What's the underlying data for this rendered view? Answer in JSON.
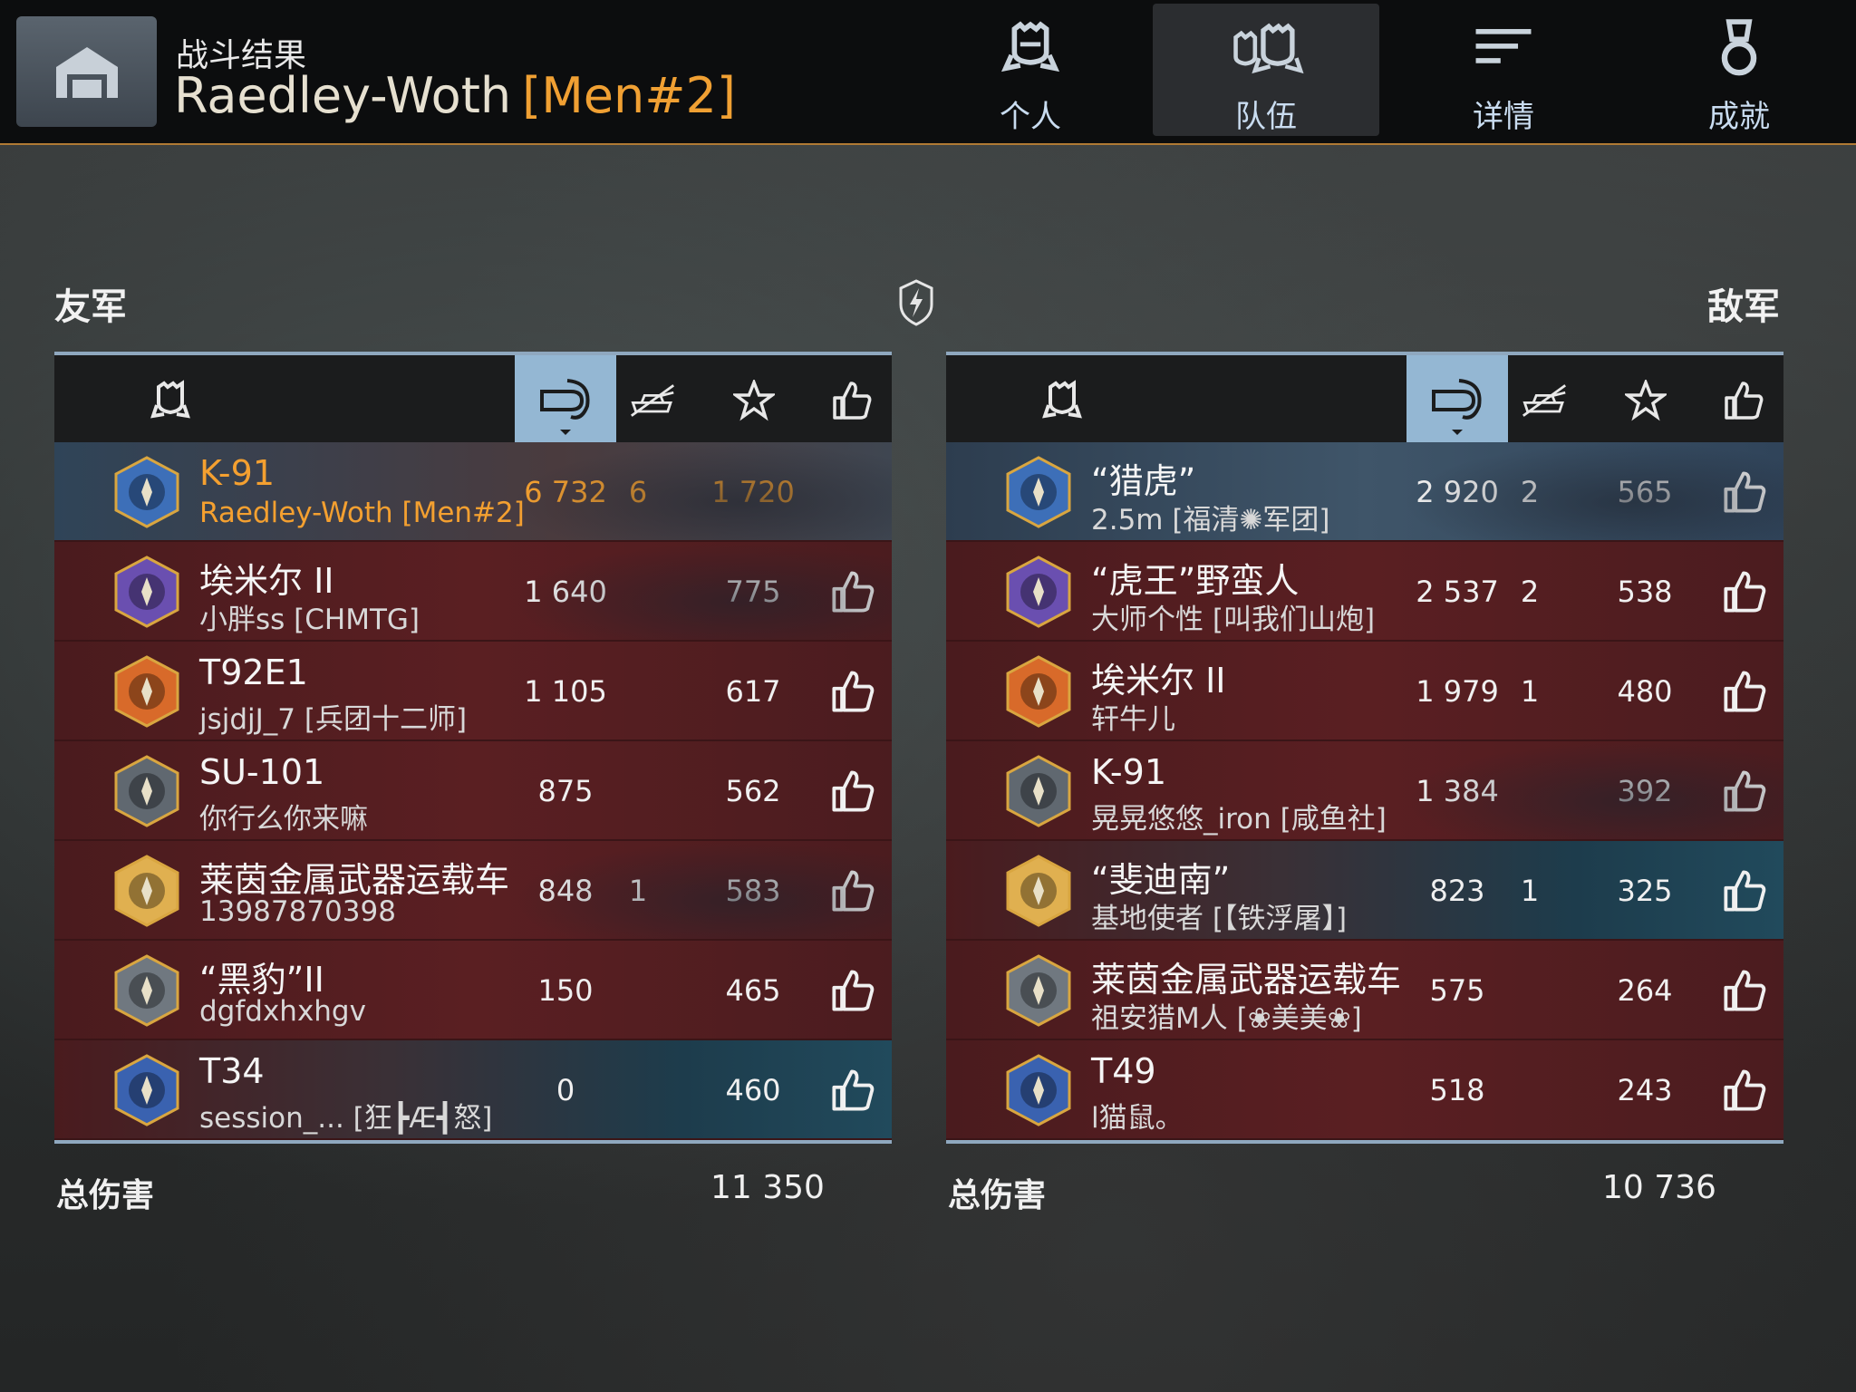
{
  "header": {
    "title_small": "战斗结果",
    "player_name": "Raedley-Woth",
    "clan_tag": "[Men#2]",
    "tabs": [
      {
        "label": "个人",
        "icon": "crew-member-icon",
        "active": false
      },
      {
        "label": "队伍",
        "icon": "team-icon",
        "active": true
      },
      {
        "label": "详情",
        "icon": "details-lines-icon",
        "active": false
      },
      {
        "label": "成就",
        "icon": "medal-icon",
        "active": false
      }
    ]
  },
  "allies": {
    "label": "友军",
    "total_label": "总伤害",
    "total_damage": "11 350",
    "players": [
      {
        "tank": "K-91",
        "player": "Raedley-Woth [Men#2]",
        "damage": "6 732",
        "kills": "6",
        "exp": "1 720",
        "liked": false,
        "self": true,
        "style": "self"
      },
      {
        "tank": "埃米尔 II",
        "player": "小胖ss [CHMTG]",
        "damage": "1 640",
        "kills": "",
        "exp": "775",
        "liked": true,
        "self": false,
        "style": "tank"
      },
      {
        "tank": "T92E1",
        "player": "jsjdjJ_7 [兵团十二师]",
        "damage": "1 105",
        "kills": "",
        "exp": "617",
        "liked": true,
        "self": false,
        "style": "red"
      },
      {
        "tank": "SU-101",
        "player": "你行么你来嘛",
        "damage": "875",
        "kills": "",
        "exp": "562",
        "liked": true,
        "self": false,
        "style": "red"
      },
      {
        "tank": "莱茵金属武器运载车",
        "player": "13987870398",
        "damage": "848",
        "kills": "1",
        "exp": "583",
        "liked": true,
        "self": false,
        "style": "tank"
      },
      {
        "tank": "“黑豹”II",
        "player": "dgfdxhxhgv",
        "damage": "150",
        "kills": "",
        "exp": "465",
        "liked": true,
        "self": false,
        "style": "red"
      },
      {
        "tank": "T34",
        "player": "session_...  [狂┣Æ┫怒]",
        "damage": "0",
        "kills": "",
        "exp": "460",
        "liked": true,
        "self": false,
        "style": "teal"
      }
    ]
  },
  "enemies": {
    "label": "敌军",
    "total_label": "总伤害",
    "total_damage": "10 736",
    "players": [
      {
        "tank": "“猎虎”",
        "player": "2.5m [福清✺军团]",
        "damage": "2 920",
        "kills": "2",
        "exp": "565",
        "liked": true,
        "style": "blue"
      },
      {
        "tank": "“虎王”野蛮人",
        "player": "大师个性 [叫我们山炮]",
        "damage": "2 537",
        "kills": "2",
        "exp": "538",
        "liked": true,
        "style": "red"
      },
      {
        "tank": "埃米尔 II",
        "player": "轩牛儿",
        "damage": "1 979",
        "kills": "1",
        "exp": "480",
        "liked": true,
        "style": "red"
      },
      {
        "tank": "K-91",
        "player": "晃晃悠悠_iron [咸鱼社]",
        "damage": "1 384",
        "kills": "",
        "exp": "392",
        "liked": true,
        "style": "tank"
      },
      {
        "tank": "“斐迪南”",
        "player": "基地使者 [【铁浮屠】]",
        "damage": "823",
        "kills": "1",
        "exp": "325",
        "liked": true,
        "style": "teal"
      },
      {
        "tank": "莱茵金属武器运载车",
        "player": "祖安猎M人 [❀美美❀]",
        "damage": "575",
        "kills": "",
        "exp": "264",
        "liked": true,
        "style": "red"
      },
      {
        "tank": "T49",
        "player": "l猫鼠。",
        "damage": "518",
        "kills": "",
        "exp": "243",
        "liked": true,
        "style": "red"
      }
    ]
  },
  "colors": {
    "accent_orange": "#f0a033",
    "panel_red": "#5a1f22",
    "header_blue": "#94b7d3"
  }
}
